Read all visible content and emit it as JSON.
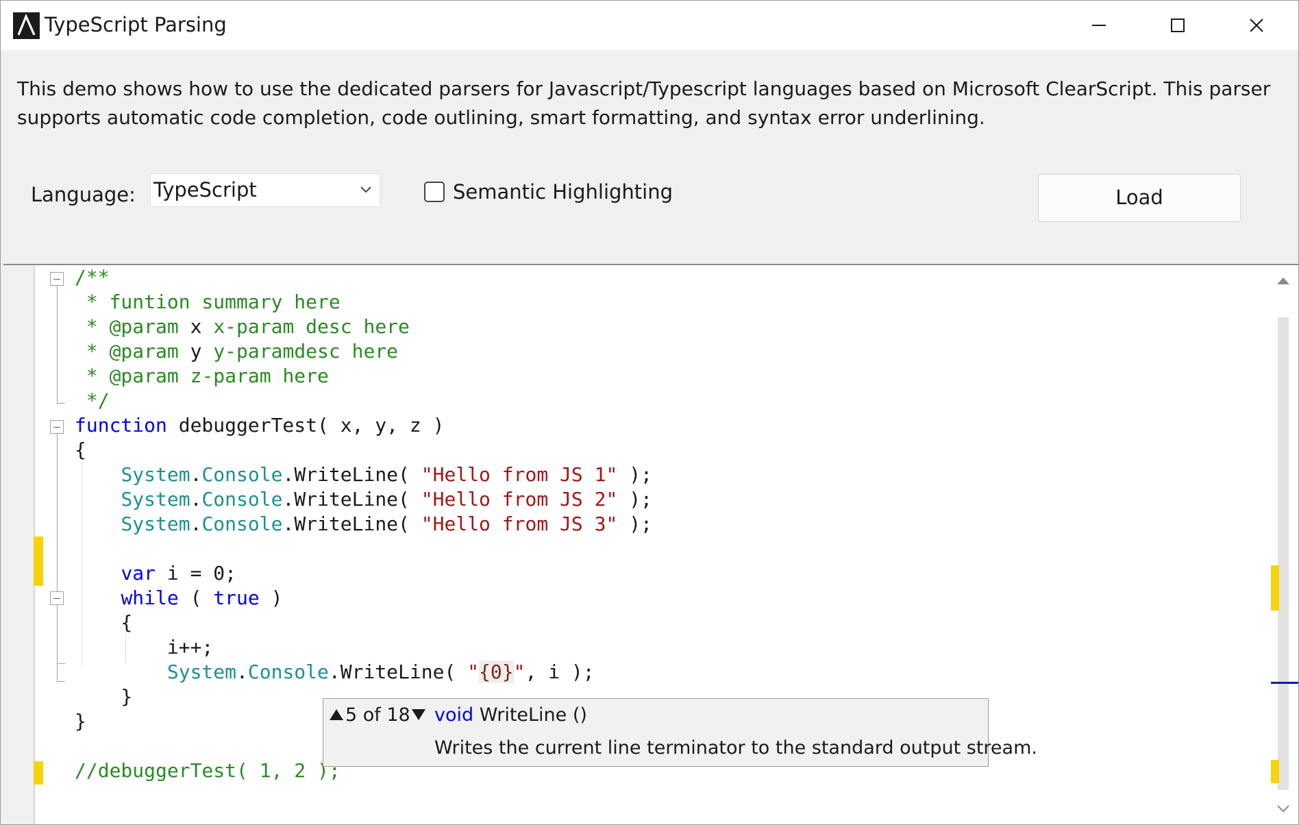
{
  "window": {
    "title": "TypeScript Parsing",
    "icon": "app-logo-icon"
  },
  "description": "This demo shows how to use the dedicated parsers for Javascript/Typescript languages based on Microsoft ClearScript. This parser supports automatic code completion, code outlining, smart formatting, and syntax error underlining.",
  "options": {
    "language_label": "Language:",
    "language_value": "TypeScript",
    "semantic_label": "Semantic Highlighting",
    "semantic_checked": false,
    "load_label": "Load"
  },
  "editor": {
    "lines": [
      [
        {
          "t": "/**",
          "c": "cmt"
        }
      ],
      [
        {
          "t": " * funtion summary here",
          "c": "cmt"
        }
      ],
      [
        {
          "t": " * ",
          "c": "cmt"
        },
        {
          "t": "@param",
          "c": "cmt"
        },
        {
          "t": " x ",
          "c": "tag"
        },
        {
          "t": "x-param desc here",
          "c": "cmt"
        }
      ],
      [
        {
          "t": " * ",
          "c": "cmt"
        },
        {
          "t": "@param",
          "c": "cmt"
        },
        {
          "t": " y ",
          "c": "tag"
        },
        {
          "t": "y-paramdesc here",
          "c": "cmt"
        }
      ],
      [
        {
          "t": " * ",
          "c": "cmt"
        },
        {
          "t": "@param",
          "c": "cmt"
        },
        {
          "t": " z-param here",
          "c": "cmt"
        }
      ],
      [
        {
          "t": " */",
          "c": "cmt"
        }
      ],
      [
        {
          "t": "function",
          "c": "kw"
        },
        {
          "t": " debuggerTest( x, y, z )",
          "c": "pl"
        }
      ],
      [
        {
          "t": "{",
          "c": "pl"
        }
      ],
      [
        {
          "t": "    ",
          "c": "pl"
        },
        {
          "t": "System",
          "c": "tp"
        },
        {
          "t": ".",
          "c": "pl"
        },
        {
          "t": "Console",
          "c": "tp"
        },
        {
          "t": ".WriteLine( ",
          "c": "pl"
        },
        {
          "t": "\"Hello from JS 1\"",
          "c": "str"
        },
        {
          "t": " );",
          "c": "pl"
        }
      ],
      [
        {
          "t": "    ",
          "c": "pl"
        },
        {
          "t": "System",
          "c": "tp"
        },
        {
          "t": ".",
          "c": "pl"
        },
        {
          "t": "Console",
          "c": "tp"
        },
        {
          "t": ".WriteLine( ",
          "c": "pl"
        },
        {
          "t": "\"Hello from JS 2\"",
          "c": "str"
        },
        {
          "t": " );",
          "c": "pl"
        }
      ],
      [
        {
          "t": "    ",
          "c": "pl"
        },
        {
          "t": "System",
          "c": "tp"
        },
        {
          "t": ".",
          "c": "pl"
        },
        {
          "t": "Console",
          "c": "tp"
        },
        {
          "t": ".WriteLine( ",
          "c": "pl"
        },
        {
          "t": "\"Hello from JS 3\"",
          "c": "str"
        },
        {
          "t": " );",
          "c": "pl"
        }
      ],
      [
        {
          "t": "",
          "c": "pl"
        }
      ],
      [
        {
          "t": "    ",
          "c": "pl"
        },
        {
          "t": "var",
          "c": "kw"
        },
        {
          "t": " i = 0;",
          "c": "pl"
        }
      ],
      [
        {
          "t": "    ",
          "c": "pl"
        },
        {
          "t": "while",
          "c": "kw"
        },
        {
          "t": " ( ",
          "c": "pl"
        },
        {
          "t": "true",
          "c": "kw"
        },
        {
          "t": " )",
          "c": "pl"
        }
      ],
      [
        {
          "t": "    {",
          "c": "pl"
        }
      ],
      [
        {
          "t": "        i++;",
          "c": "pl"
        }
      ],
      [
        {
          "t": "        ",
          "c": "pl"
        },
        {
          "t": "System",
          "c": "tp"
        },
        {
          "t": ".",
          "c": "pl"
        },
        {
          "t": "Console",
          "c": "tp"
        },
        {
          "t": ".WriteLine( ",
          "c": "pl"
        },
        {
          "t": "\"",
          "c": "str"
        },
        {
          "t": "{0}",
          "c": "esc"
        },
        {
          "t": "\"",
          "c": "str"
        },
        {
          "t": ", i );",
          "c": "pl"
        }
      ],
      [
        {
          "t": "    }",
          "c": "pl"
        }
      ],
      [
        {
          "t": "}",
          "c": "pl"
        }
      ],
      [
        {
          "t": "",
          "c": "pl"
        }
      ],
      [
        {
          "t": "//debuggerTest( 1, 2 );",
          "c": "cmt"
        }
      ]
    ]
  },
  "tooltip": {
    "counter": "5 of 18",
    "return_type": "void",
    "signature": "WriteLine ()",
    "description": "Writes the current line terminator to the standard output stream."
  },
  "colors": {
    "comment": "#2a8a22",
    "keyword": "#0000ee",
    "type": "#1f8f8f",
    "string": "#a31515",
    "change_marker": "#f7d40a"
  }
}
